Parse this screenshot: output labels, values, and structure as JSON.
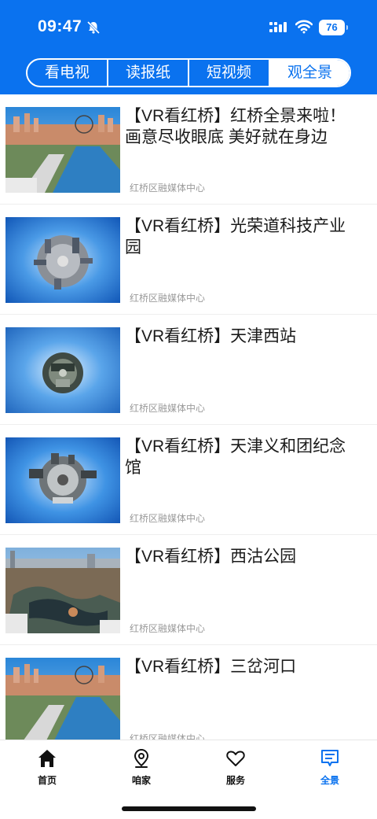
{
  "status_bar": {
    "time": "09:47",
    "battery": "76"
  },
  "tabs": [
    {
      "label": "看电视",
      "active": false
    },
    {
      "label": "读报纸",
      "active": false
    },
    {
      "label": "短视频",
      "active": false
    },
    {
      "label": "观全景",
      "active": true
    }
  ],
  "items": [
    {
      "title": "【VR看红桥】红桥全景来啦！画意尽收眼底 美好就在身边",
      "source": "红桥区融媒体中心",
      "thumbnail": "city-riverside-aerial"
    },
    {
      "title": "【VR看红桥】光荣道科技产业园",
      "source": "红桥区融媒体中心",
      "thumbnail": "tiny-planet-buildings"
    },
    {
      "title": "【VR看红桥】天津西站",
      "source": "红桥区融媒体中心",
      "thumbnail": "tiny-planet-station"
    },
    {
      "title": "【VR看红桥】天津义和团纪念馆",
      "source": "红桥区融媒体中心",
      "thumbnail": "tiny-planet-memorial"
    },
    {
      "title": "【VR看红桥】西沽公园",
      "source": "红桥区融媒体中心",
      "thumbnail": "park-winter-aerial"
    },
    {
      "title": "【VR看红桥】三岔河口",
      "source": "红桥区融媒体中心",
      "thumbnail": "city-riverside-aerial"
    }
  ],
  "bottom_nav": [
    {
      "label": "首页",
      "icon": "home-icon",
      "active": false
    },
    {
      "label": "咱家",
      "icon": "location-pin-icon",
      "active": false
    },
    {
      "label": "服务",
      "icon": "heart-icon",
      "active": false
    },
    {
      "label": "全景",
      "icon": "message-icon",
      "active": true
    }
  ],
  "colors": {
    "brand": "#0a72ef",
    "text": "#1a1a1a",
    "muted": "#9a9a9a"
  }
}
